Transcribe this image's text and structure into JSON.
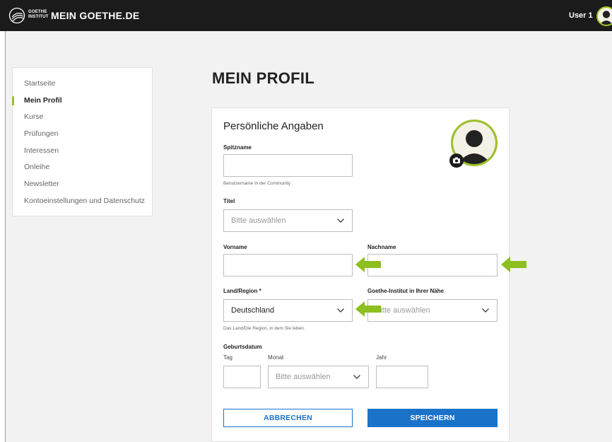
{
  "header": {
    "logo_text_line1": "GOETHE",
    "logo_text_line2": "INSTITUT",
    "site_title": "MEIN GOETHE.DE",
    "user_name": "User 1"
  },
  "sidebar": {
    "items": [
      {
        "label": "Startseite",
        "active": false
      },
      {
        "label": "Mein Profil",
        "active": true
      },
      {
        "label": "Kurse",
        "active": false
      },
      {
        "label": "Prüfungen",
        "active": false
      },
      {
        "label": "Interessen",
        "active": false
      },
      {
        "label": "Onleihe",
        "active": false
      },
      {
        "label": "Newsletter",
        "active": false
      },
      {
        "label": "Kontoeinstellungen und Datenschutz",
        "active": false
      }
    ]
  },
  "page": {
    "title": "MEIN PROFIL"
  },
  "form": {
    "section_title": "Persönliche Angaben",
    "nickname": {
      "label": "Spitzname",
      "value": "",
      "hint": "Benutzername in der Community"
    },
    "title": {
      "label": "Titel",
      "selected": "Bitte auswählen"
    },
    "first_name": {
      "label": "Vorname",
      "value": ""
    },
    "last_name": {
      "label": "Nachname",
      "value": ""
    },
    "country": {
      "label": "Land/Region *",
      "selected": "Deutschland",
      "hint": "Das Land/Die Region, in dem Sie leben."
    },
    "institute": {
      "label": "Goethe-Institut in Ihrer Nähe",
      "selected": "Bitte auswählen"
    },
    "birthdate": {
      "label": "Geburtsdatum",
      "day_label": "Tag",
      "month_label": "Monat",
      "month_selected": "Bitte auswählen",
      "year_label": "Jahr"
    },
    "cancel_label": "ABBRECHEN",
    "save_label": "SPEICHERN"
  },
  "colors": {
    "accent_green": "#9fc12b",
    "primary_blue": "#1a73c9",
    "header_bg": "#1b1b1b"
  },
  "icons": [
    "goethe-logo-icon",
    "user-avatar-icon",
    "camera-icon",
    "chevron-down-icon",
    "arrow-left-icon"
  ]
}
